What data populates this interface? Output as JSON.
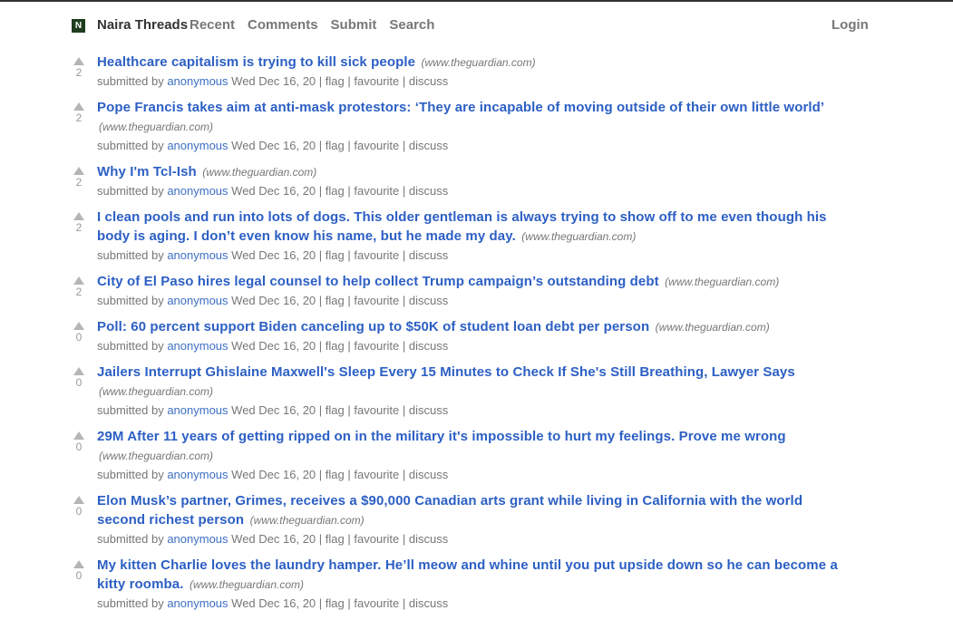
{
  "header": {
    "logo_letter": "N",
    "site_name": "Naira Threads",
    "nav": [
      "Recent",
      "Comments",
      "Submit",
      "Search"
    ],
    "login": "Login"
  },
  "meta_labels": {
    "submitted_by": "submitted by",
    "sep": "|",
    "flag": "flag",
    "favourite": "favourite",
    "discuss": "discuss"
  },
  "stories": [
    {
      "score": "2",
      "title": "Healthcare capitalism is trying to kill sick people",
      "domain": "(www.theguardian.com)",
      "author": "anonymous",
      "date": "Wed Dec 16, 20"
    },
    {
      "score": "2",
      "title": "Pope Francis takes aim at anti-mask protestors: ‘They are incapable of moving outside of their own little world’",
      "domain": "(www.theguardian.com)",
      "author": "anonymous",
      "date": "Wed Dec 16, 20"
    },
    {
      "score": "2",
      "title": "Why I'm Tcl-Ish",
      "domain": "(www.theguardian.com)",
      "author": "anonymous",
      "date": "Wed Dec 16, 20"
    },
    {
      "score": "2",
      "title": "I clean pools and run into lots of dogs. This older gentleman is always trying to show off to me even though his body is aging. I don’t even know his name, but he made my day.",
      "domain": "(www.theguardian.com)",
      "author": "anonymous",
      "date": "Wed Dec 16, 20"
    },
    {
      "score": "2",
      "title": "City of El Paso hires legal counsel to help collect Trump campaign’s outstanding debt",
      "domain": "(www.theguardian.com)",
      "author": "anonymous",
      "date": "Wed Dec 16, 20"
    },
    {
      "score": "0",
      "title": "Poll: 60 percent support Biden canceling up to $50K of student loan debt per person",
      "domain": "(www.theguardian.com)",
      "author": "anonymous",
      "date": "Wed Dec 16, 20"
    },
    {
      "score": "0",
      "title": "Jailers Interrupt Ghislaine Maxwell's Sleep Every 15 Minutes to Check If She's Still Breathing, Lawyer Says",
      "domain": "(www.theguardian.com)",
      "author": "anonymous",
      "date": "Wed Dec 16, 20"
    },
    {
      "score": "0",
      "title": "29M After 11 years of getting ripped on in the military it's impossible to hurt my feelings. Prove me wrong",
      "domain": "(www.theguardian.com)",
      "author": "anonymous",
      "date": "Wed Dec 16, 20"
    },
    {
      "score": "0",
      "title": "Elon Musk’s partner, Grimes, receives a $90,000 Canadian arts grant while living in California with the world second richest person",
      "domain": "(www.theguardian.com)",
      "author": "anonymous",
      "date": "Wed Dec 16, 20"
    },
    {
      "score": "0",
      "title": "My kitten Charlie loves the laundry hamper. He’ll meow and whine until you put upside down so he can become a kitty roomba.",
      "domain": "(www.theguardian.com)",
      "author": "anonymous",
      "date": "Wed Dec 16, 20"
    }
  ]
}
